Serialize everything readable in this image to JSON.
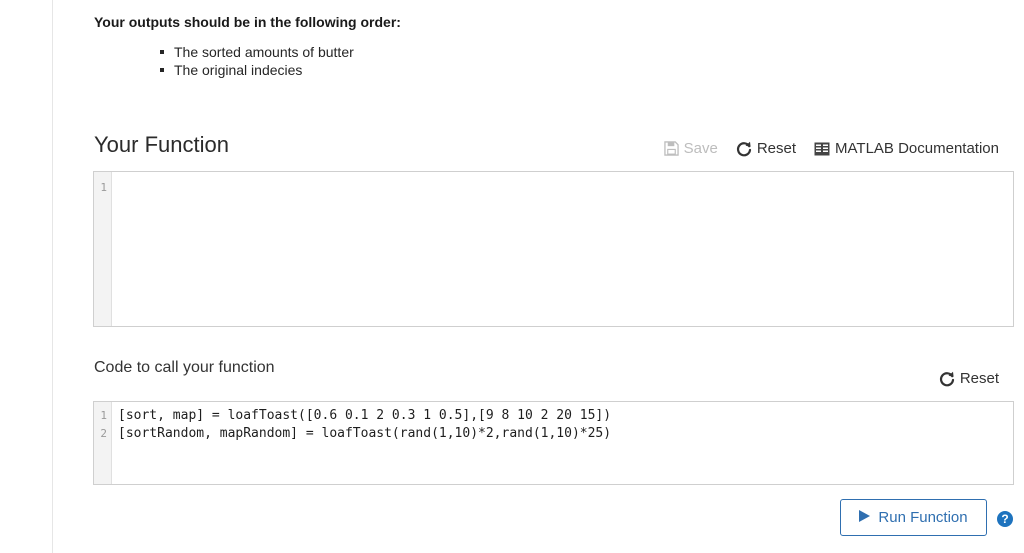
{
  "instructions": {
    "heading": "Your outputs should be in the following order:",
    "items": [
      "The sorted amounts of butter",
      "The original indecies"
    ]
  },
  "function_section": {
    "title": "Your Function",
    "toolbar": {
      "save_label": "Save",
      "reset_label": "Reset",
      "docs_label": "MATLAB Documentation"
    },
    "editor": {
      "line_numbers": [
        "1"
      ],
      "lines": [
        ""
      ]
    }
  },
  "call_section": {
    "title": "Code to call your function",
    "reset_label": "Reset",
    "editor": {
      "line_numbers": [
        "1",
        "2"
      ],
      "lines": [
        "[sort, map] = loafToast([0.6 0.1 2 0.3 1 0.5],[9 8 10 2 20 15])",
        "[sortRandom, mapRandom] = loafToast(rand(1,10)*2,rand(1,10)*25)"
      ]
    }
  },
  "actions": {
    "run_label": "Run Function",
    "help_symbol": "?"
  },
  "icons": {
    "save": "floppy-disk-icon",
    "reset": "circular-arrow-icon",
    "docs": "book-icon",
    "run": "play-triangle-icon",
    "help": "question-circle-icon"
  },
  "colors": {
    "accent": "#2f6fb0",
    "help": "#1e73be",
    "disabled": "#bdbdbd"
  }
}
